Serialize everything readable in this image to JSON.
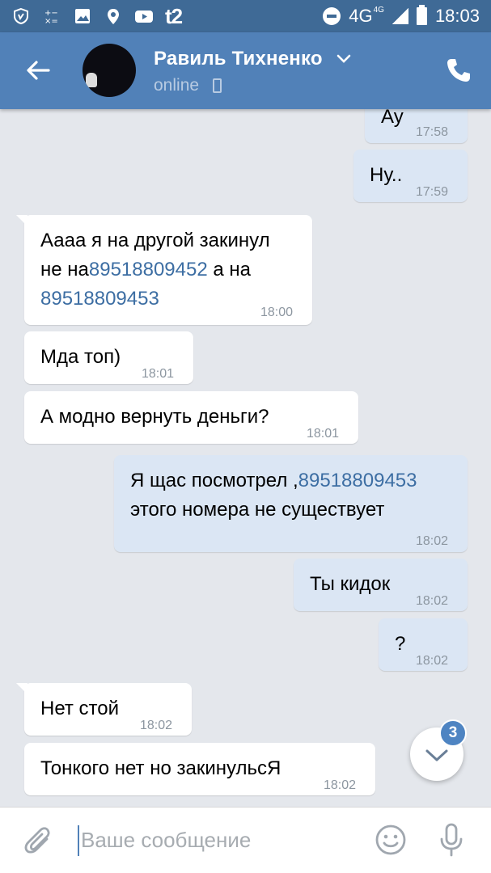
{
  "statusbar": {
    "carrier": "t2",
    "network": "4G",
    "network_small": "4G",
    "time": "18:03",
    "icons": [
      "shield-icon",
      "calculator-icon",
      "gallery-icon",
      "location-icon",
      "youtube-icon",
      "dnd-icon",
      "signal-icon",
      "battery-icon"
    ]
  },
  "header": {
    "name": "Равиль Тихненко",
    "status": "online",
    "icons": [
      "back-arrow-icon",
      "chevron-down-icon",
      "phone-icon"
    ]
  },
  "messages": [
    {
      "side": "out",
      "text": "Ау",
      "time": "17:58"
    },
    {
      "side": "out",
      "text": "Ну..",
      "time": "17:59"
    },
    {
      "side": "in",
      "lines": [
        "Аааа я на другой закинул",
        "не на",
        "89518809452",
        " а на",
        "89518809453"
      ],
      "time": "18:00"
    },
    {
      "side": "in",
      "text": "Мда топ)",
      "time": "18:01"
    },
    {
      "side": "in",
      "text": "А модно вернуть деньги?",
      "time": "18:01"
    },
    {
      "side": "out",
      "text_before": "Я щас посмотрел ,",
      "link": "89518809453",
      "text_after": "этого номера не существует",
      "time": "18:02"
    },
    {
      "side": "out",
      "text": "Ты кидок",
      "time": "18:02"
    },
    {
      "side": "out",
      "text": "?",
      "time": "18:02"
    },
    {
      "side": "in",
      "text": "Нет стой",
      "time": "18:02"
    },
    {
      "side": "in",
      "text": "Тонкого нет но закинульсЯ",
      "time": "18:02"
    }
  ],
  "scroll_button": {
    "badge": "3",
    "icon": "chevron-down-icon"
  },
  "composer": {
    "placeholder": "Ваше сообщение",
    "icons": [
      "paperclip-icon",
      "smile-icon",
      "microphone-icon"
    ]
  },
  "colors": {
    "header": "#5181b8",
    "statusbar": "#3f6a96",
    "outgoing": "#dbe6f4",
    "incoming": "#ffffff",
    "link": "#3d6ea3",
    "background": "#e4e7ec"
  }
}
